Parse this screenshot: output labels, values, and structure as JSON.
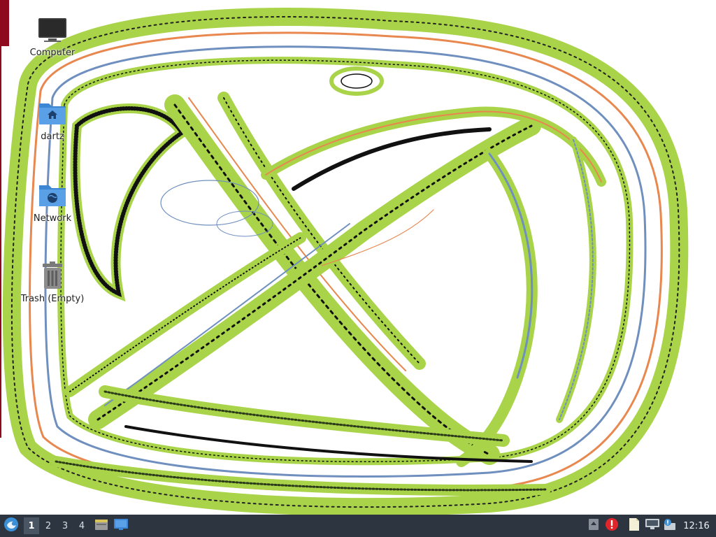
{
  "desktop": {
    "icons": [
      {
        "label": "Computer",
        "icon": "computer-monitor-icon"
      },
      {
        "label": "dartz",
        "icon": "home-folder-icon"
      },
      {
        "label": "Network",
        "icon": "network-folder-icon"
      },
      {
        "label": "Trash (Empty)",
        "icon": "trash-icon"
      }
    ],
    "wallpaper": "abstract-striped-highway-loops"
  },
  "taskbar": {
    "start_icon": "start-menu-icon",
    "workspaces": [
      "1",
      "2",
      "3",
      "4"
    ],
    "active_workspace": "1",
    "launchers": [
      "file-manager-icon",
      "show-desktop-icon"
    ],
    "tray": [
      "tray-expand-icon",
      "alert-icon",
      "clipboard-icon",
      "network-status-icon",
      "update-notifier-icon"
    ],
    "clock": "12:16"
  },
  "colors": {
    "taskbar_bg": "#2c3540",
    "active_workspace_bg": "#4a5563",
    "folder_blue": "#3d86d4",
    "alert_red": "#e0262a",
    "stripe_green": "#a9d44a",
    "stripe_orange": "#e8874e",
    "stripe_blue": "#6f8fbf",
    "accent_red": "#8e0b1e"
  }
}
